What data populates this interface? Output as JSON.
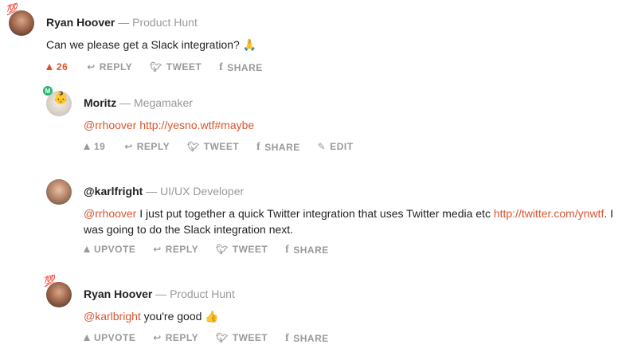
{
  "comments": [
    {
      "author": "Ryan Hoover",
      "separator": "—",
      "role": "Product Hunt",
      "badge": "💯",
      "text": "Can we please get a Slack integration?",
      "emoji": "🙏",
      "upvote_count": "26",
      "reply_label": "REPLY",
      "tweet_label": "TWEET",
      "share_label": "SHARE"
    },
    {
      "author": "Moritz",
      "separator": "—",
      "role": "Megamaker",
      "badge": "M",
      "mention": "@rrhoover",
      "link": "http://yesno.wtf#maybe",
      "upvote_count": "19",
      "reply_label": "REPLY",
      "tweet_label": "TWEET",
      "share_label": "SHARE",
      "edit_label": "EDIT"
    },
    {
      "author": "@karlfright",
      "separator": "—",
      "role": "UI/UX Developer",
      "mention": "@rrhoover",
      "text_a": " I just put together a quick Twitter integration that uses Twitter media etc ",
      "link": "http://twitter.com/ynwtf",
      "text_b": ". I was going to do the Slack integration next.",
      "upvote_label": "UPVOTE",
      "reply_label": "REPLY",
      "tweet_label": "TWEET",
      "share_label": "SHARE"
    },
    {
      "author": "Ryan Hoover",
      "separator": "—",
      "role": "Product Hunt",
      "badge": "💯",
      "mention": "@karlbright",
      "text": " you're good",
      "emoji": "👍",
      "upvote_label": "UPVOTE",
      "reply_label": "REPLY",
      "tweet_label": "TWEET",
      "share_label": "SHARE"
    }
  ],
  "icons": {
    "upvote": "upvote-triangle-icon",
    "reply": "reply-arrow-icon",
    "tweet": "twitter-bird-icon",
    "share": "facebook-f-icon",
    "edit": "pencil-icon"
  },
  "colors": {
    "accent": "#da552f",
    "muted": "#999999",
    "text": "#222222"
  }
}
